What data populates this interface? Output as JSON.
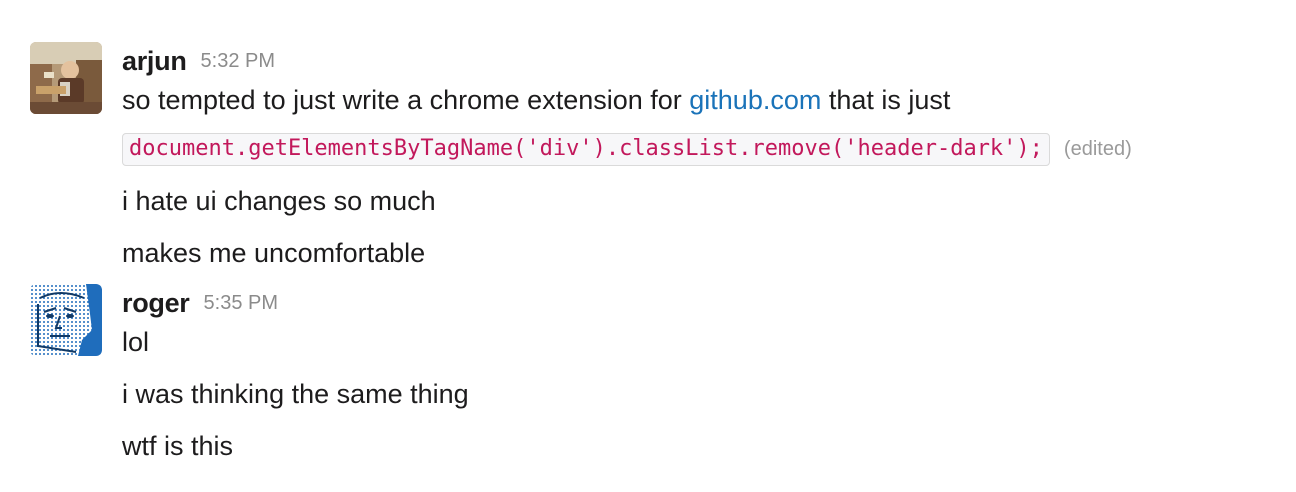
{
  "messages": [
    {
      "user": "arjun",
      "time": "5:32 PM",
      "line1_prefix": "so tempted to just write a chrome extension for ",
      "line1_link": "github.com",
      "line1_suffix": " that is just",
      "code": "document.getElementsByTagName('div').classList.remove('header-dark');",
      "edited": "(edited)",
      "line3": "i hate ui changes so much",
      "line4": "makes me uncomfortable"
    },
    {
      "user": "roger",
      "time": "5:35 PM",
      "line1": "lol",
      "line2": "i was thinking the same thing",
      "line3": "wtf is this"
    }
  ],
  "colors": {
    "link": "#1a73b9",
    "code_text": "#c2185b",
    "timestamp": "#8b8b8b",
    "roger_avatar_blue": "#1f6dbc"
  }
}
